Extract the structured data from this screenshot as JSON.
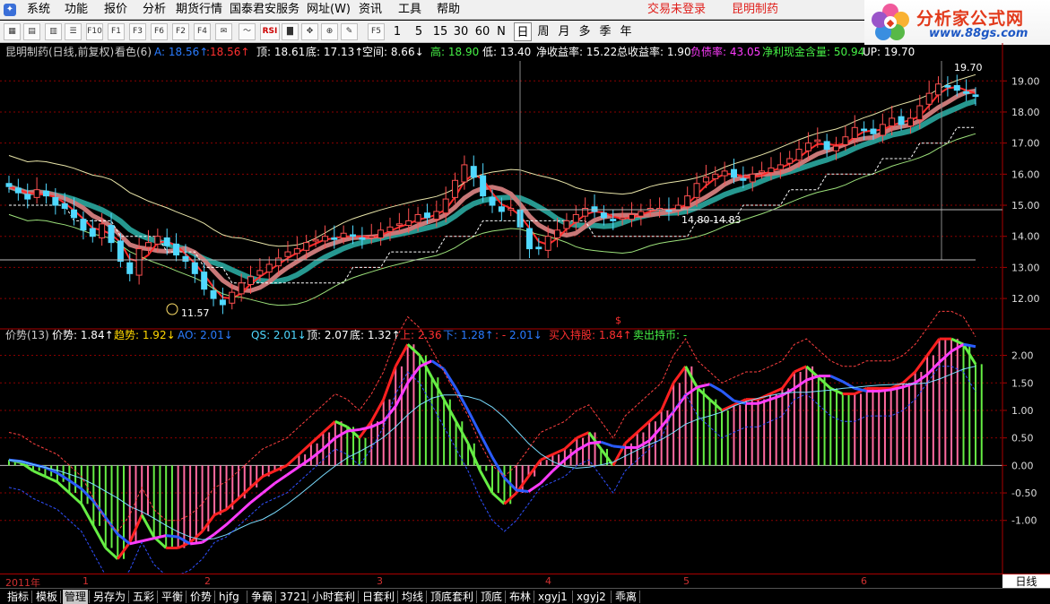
{
  "menubar": {
    "items": [
      "系统",
      "功能",
      "报价",
      "分析",
      "期货行情",
      "国泰君安服务",
      "网址(W)",
      "资讯",
      "工具",
      "帮助"
    ],
    "login_status": "交易未登录",
    "stock_name": "昆明制药"
  },
  "logo": {
    "brand": "分析家公式网",
    "url": "www.88gs.com"
  },
  "toolbar": {
    "rsi": "RSI",
    "f5": "F5",
    "periods": [
      "1",
      "5",
      "15",
      "30",
      "60",
      "N",
      "日",
      "周",
      "月",
      "多",
      "季",
      "年"
    ],
    "active_period": "日"
  },
  "main_info": {
    "title": "昆明制药(日线,前复权)",
    "look_label": "看色(6)",
    "a_label": "A: 18.56↑",
    "a2": ":18.56↑",
    "top": "顶: 18.61",
    "bottom": "底: 17.13↑",
    "space": "空间: 8.66↓",
    "high": "高: 18.90",
    "low": "低: 13.40",
    "net_yield": "净收益率: 15.22",
    "total_yield": "总收益率: 1.90",
    "debt": "负债率: 43.05",
    "cash": "净利现金含量: 50.94",
    "up": "UP: 19.70"
  },
  "main_chart": {
    "y_ticks": [
      "19.00",
      "18.00",
      "17.00",
      "16.00",
      "15.00",
      "14.00",
      "13.00",
      "12.00"
    ],
    "y_values": [
      19,
      18,
      17,
      16,
      15,
      14,
      13,
      12
    ],
    "high_label": "19.70",
    "low_label": "11.57",
    "mid_label": "14.80 14.83"
  },
  "sub_info": {
    "title": "价势(13)",
    "jiashi": "价势: 1.84↑",
    "qushi": "趋势: 1.92↓",
    "ao": "AO: 2.01↓",
    "qs": "QS: 2.01↓",
    "ding": "顶: 2.07",
    "di": "底: 1.32↑",
    "shang": "上: 2.36",
    "xia": "下: 1.28↑",
    "colon": ": - ",
    "sub_val": "2.01↓",
    "buy": "买入持股: 1.84↑",
    "sell": "卖出持币: -"
  },
  "sub_chart": {
    "y_ticks": [
      "2.00",
      "1.50",
      "1.00",
      "0.50",
      "0.00",
      "-0.50",
      "-1.00"
    ],
    "y_values": [
      2.0,
      1.5,
      1.0,
      0.5,
      0.0,
      -0.5,
      -1.0
    ],
    "marker": "$"
  },
  "datebar": {
    "year": "2011年",
    "months": [
      "1",
      "2",
      "3",
      "4",
      "5",
      "6"
    ],
    "period_label": "日线"
  },
  "tabs": [
    "指标",
    "模板",
    "管理",
    "另存为",
    "五彩",
    "平衡",
    "价势",
    "hjfg",
    "争霸",
    "3721",
    "小时套利",
    "日套利",
    "均线",
    "顶底套利",
    "顶底",
    "布林",
    "xgyj1",
    "xgyj2",
    "乖离"
  ],
  "active_tab": "管理",
  "colors": {
    "up": "#ff5050",
    "down": "#50d8ff",
    "rising_line": "#ff2a2a",
    "trend_line": "#2aa8a0",
    "grid": "#8b0000",
    "pink": "#ff6aa0",
    "green": "#66ee44",
    "magenta": "#ff3cff"
  },
  "chart_data": [
    {
      "type": "candlestick",
      "title": "昆明制药(日线,前复权)",
      "ylim": [
        11.5,
        19.7
      ],
      "annotations": [
        "19.70",
        "11.57",
        "14.80 14.83"
      ],
      "close": [
        15.6,
        15.4,
        15.2,
        15.5,
        15.3,
        15.0,
        14.9,
        14.6,
        14.2,
        14.0,
        14.4,
        13.8,
        13.2,
        12.8,
        13.6,
        13.8,
        14.0,
        13.7,
        13.4,
        13.2,
        12.8,
        12.3,
        12.0,
        11.8,
        12.2,
        12.5,
        12.7,
        12.9,
        13.1,
        13.3,
        13.5,
        13.6,
        13.8,
        13.9,
        14.0,
        13.9,
        14.1,
        14.0,
        13.9,
        14.0,
        14.2,
        14.3,
        14.4,
        14.5,
        14.7,
        14.6,
        14.8,
        15.2,
        15.8,
        16.3,
        15.9,
        15.3,
        15.0,
        14.8,
        14.9,
        14.3,
        13.6,
        13.6,
        14.0,
        14.2,
        14.5,
        14.7,
        14.9,
        14.8,
        14.6,
        14.5,
        14.6,
        14.7,
        14.8,
        14.9,
        14.9,
        14.8,
        15.0,
        15.3,
        15.7,
        15.9,
        16.0,
        16.1,
        15.9,
        15.8,
        16.0,
        16.1,
        16.2,
        16.3,
        16.5,
        16.8,
        17.0,
        17.1,
        16.8,
        16.9,
        17.2,
        17.5,
        17.4,
        17.3,
        17.6,
        17.8,
        17.6,
        17.8,
        18.2,
        18.6,
        18.9,
        18.8,
        18.7,
        18.6,
        18.5
      ]
    },
    {
      "type": "bar",
      "title": "价势(13)",
      "ylim": [
        -1.5,
        2.4
      ],
      "values": [
        0.1,
        0.05,
        -0.1,
        -0.2,
        -0.3,
        -0.5,
        -0.7,
        -1.1,
        -1.5,
        -1.7,
        -1.4,
        -0.9,
        -1.3,
        -1.5,
        -1.5,
        -1.4,
        -1.2,
        -0.9,
        -0.8,
        -0.6,
        -0.4,
        -0.2,
        -0.1,
        0.0,
        0.2,
        0.4,
        0.6,
        0.8,
        0.7,
        0.5,
        0.8,
        1.2,
        1.8,
        2.2,
        2.0,
        1.6,
        1.2,
        0.8,
        0.4,
        -0.1,
        -0.5,
        -0.7,
        -0.5,
        -0.2,
        0.1,
        0.2,
        0.3,
        0.5,
        0.6,
        0.3,
        0.0,
        0.4,
        0.6,
        0.8,
        1.0,
        1.5,
        1.8,
        1.4,
        1.2,
        1.0,
        1.1,
        1.2,
        1.2,
        1.3,
        1.4,
        1.7,
        1.8,
        1.6,
        1.4,
        1.3,
        1.3,
        1.4,
        1.4,
        1.4,
        1.5,
        1.7,
        2.0,
        2.3,
        2.3,
        2.2,
        1.84
      ]
    }
  ]
}
